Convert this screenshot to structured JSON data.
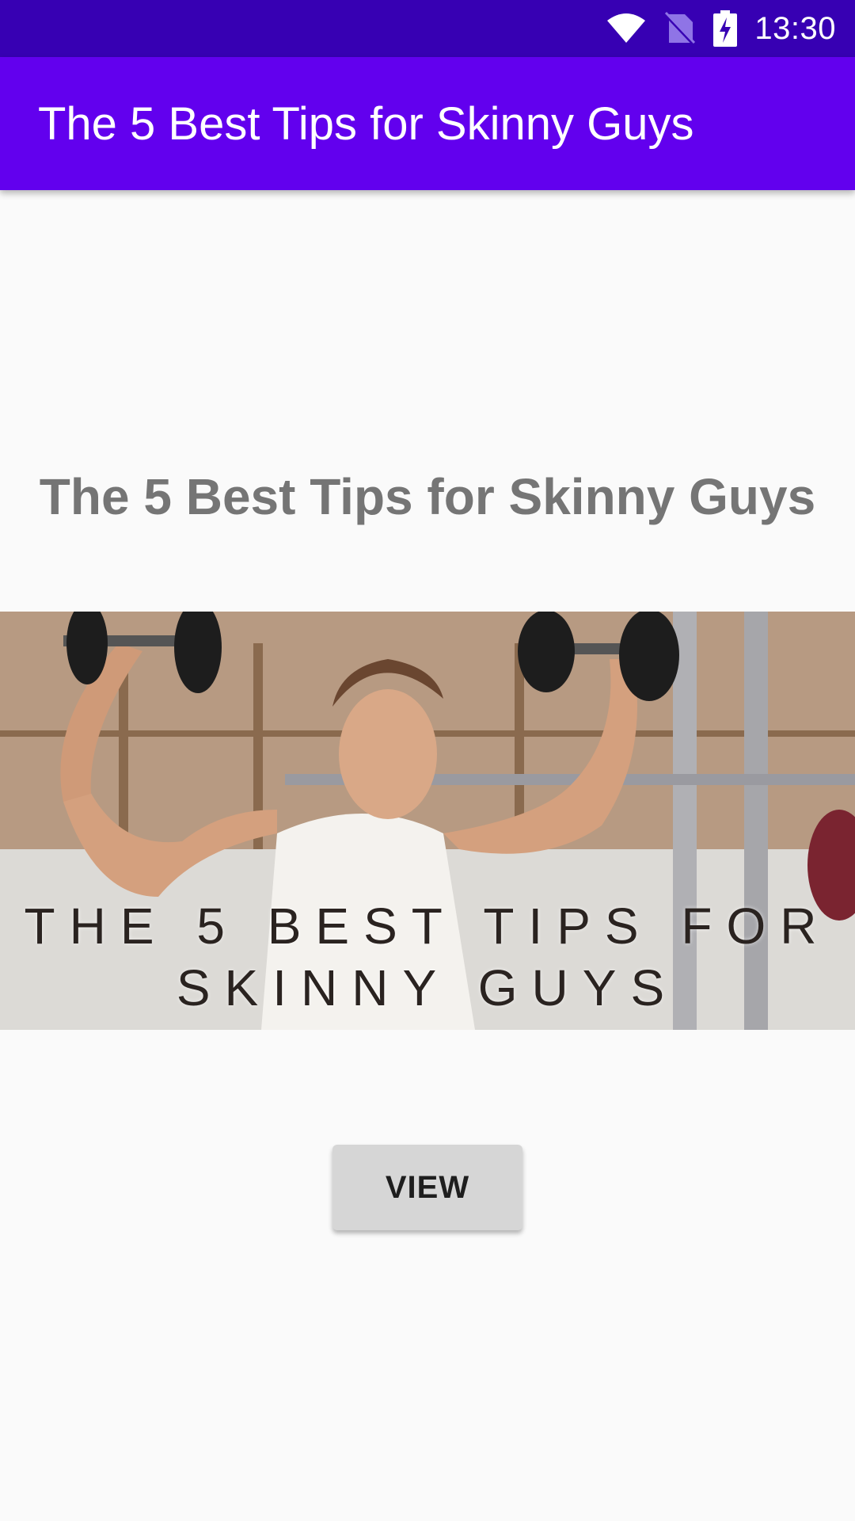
{
  "status_bar": {
    "time": "13:30",
    "icons": [
      "wifi-icon",
      "no-sim-icon",
      "battery-charging-icon"
    ]
  },
  "app_bar": {
    "title": "The 5 Best Tips for Skinny Guys",
    "color": "#6200ee"
  },
  "main": {
    "heading": "The 5 Best Tips for Skinny Guys",
    "hero_caption_line1": "THE 5 BEST TIPS FOR",
    "hero_caption_line2": "SKINNY GUYS",
    "view_button_label": "VIEW"
  },
  "colors": {
    "status_bar": "#3700b3",
    "app_bar": "#6200ee",
    "background": "#fafafa",
    "heading_text": "#757575",
    "button_bg": "#d6d6d6"
  }
}
